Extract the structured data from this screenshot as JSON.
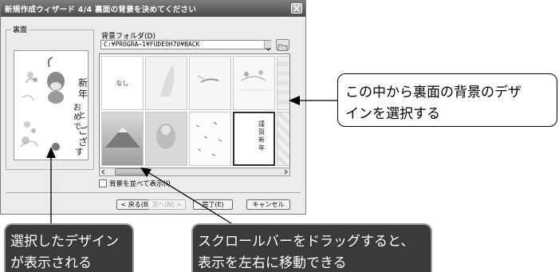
{
  "window": {
    "title": "新規作成ウィザード 4/4 裏面の背景を決めてください"
  },
  "preview_group": {
    "label": "裏面"
  },
  "folder": {
    "label": "背景フォルダ(D)",
    "path": "C:¥PROGRA~1¥FUDEOH70¥BACK"
  },
  "thumbnails": {
    "none_label": "なし",
    "selected_index": 7
  },
  "options": {
    "show_backgrounds_label": "背景を並べて表示(I)"
  },
  "buttons": {
    "back": "< 戻る(B)",
    "next": "次へ(N) >",
    "finish": "完了(E)",
    "cancel": "キャンセル"
  },
  "callouts": {
    "select_design_line1": "この中から裏面の背景のデザ",
    "select_design_line2": "インを選択する",
    "selected_shown_line1": "選択したデザイン",
    "selected_shown_line2": "が表示される",
    "scroll_line1": "スクロールバーをドラッグすると、",
    "scroll_line2": "表示を左右に移動できる"
  },
  "colors": {
    "title_bar": "#5a5a5a",
    "dialog_bg": "#ececec",
    "callout_dark": "#3a3a3a"
  }
}
